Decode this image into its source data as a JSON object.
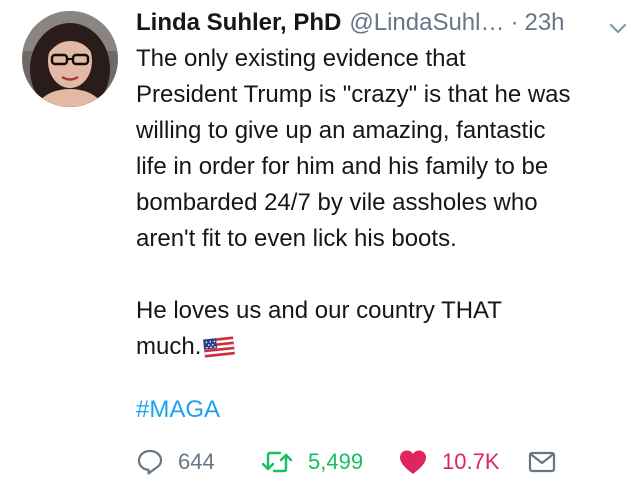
{
  "tweet": {
    "author": {
      "display_name": "Linda Suhler, PhD",
      "handle": "@LindaSuhl…",
      "avatar_icon": "user-avatar"
    },
    "separator": "·",
    "timestamp": "23h",
    "menu_icon": "chevron-down-icon",
    "text_lines": [
      "The only existing evidence that",
      "President Trump is \"crazy\" is that he was",
      "willing to give up an amazing, fantastic",
      "life in order for him and his family to be",
      "bombarded 24/7 by vile assholes who",
      "aren't fit to even lick his boots.",
      "He loves us and our country THAT",
      "much."
    ],
    "emoji": "us-flag-emoji",
    "hashtag": "#MAGA",
    "actions": {
      "reply": {
        "icon": "reply-icon",
        "count": "644"
      },
      "retweet": {
        "icon": "retweet-icon",
        "count": "5,499",
        "color": "#17bf63"
      },
      "like": {
        "icon": "heart-icon",
        "count": "10.7K",
        "color": "#e0245e"
      },
      "message": {
        "icon": "envelope-icon"
      }
    }
  },
  "colors": {
    "text": "#14171a",
    "secondary": "#657786",
    "link": "#1da1f2"
  }
}
